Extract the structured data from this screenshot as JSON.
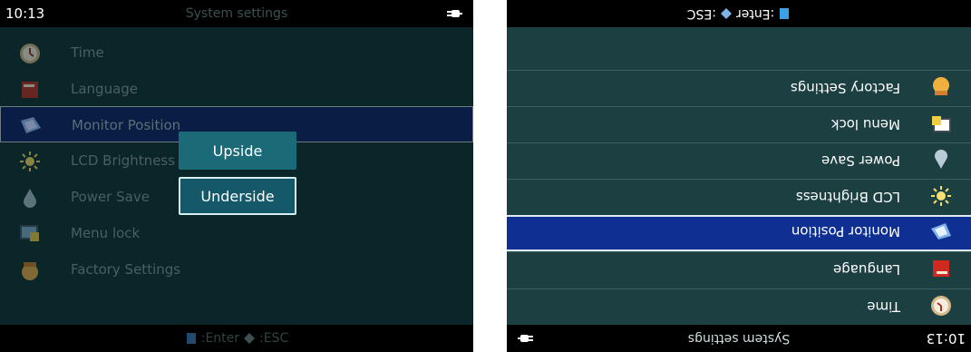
{
  "left_screen": {
    "time": "10:13",
    "title": "System settings",
    "menu": [
      {
        "label": "Time",
        "icon": "clock-icon"
      },
      {
        "label": "Language",
        "icon": "book-icon"
      },
      {
        "label": "Monitor Position",
        "icon": "monitor-icon",
        "selected": true
      },
      {
        "label": "LCD Brightness",
        "icon": "sun-icon"
      },
      {
        "label": "Power Save",
        "icon": "drop-icon"
      },
      {
        "label": "Menu lock",
        "icon": "lock-icon"
      },
      {
        "label": "Factory Settings",
        "icon": "factory-icon"
      }
    ],
    "popup": {
      "options": [
        "Upside",
        "Underside"
      ],
      "selected": "Underside"
    },
    "hint": {
      "enter": "Enter",
      "esc": "ESC"
    }
  },
  "right_screen": {
    "orientation": "upside-down",
    "time": "10:13",
    "title": "System settings",
    "menu": [
      {
        "label": "Time",
        "icon": "clock-icon"
      },
      {
        "label": "Language",
        "icon": "book-icon"
      },
      {
        "label": "Monitor Position",
        "icon": "monitor-icon",
        "selected": true
      },
      {
        "label": "LCD Brightness",
        "icon": "sun-icon"
      },
      {
        "label": "Power Save",
        "icon": "drop-icon"
      },
      {
        "label": "Menu lock",
        "icon": "lock-icon"
      },
      {
        "label": "Factory Settings",
        "icon": "factory-icon"
      }
    ],
    "hint": {
      "enter": "Enter",
      "esc": "ESC"
    }
  },
  "colors": {
    "selection_left": "#0a1d45",
    "selection_right": "#0f2f92",
    "popup": "#1b6a78",
    "bg_left": "#0b2628",
    "bg_right": "#1c3f42"
  }
}
